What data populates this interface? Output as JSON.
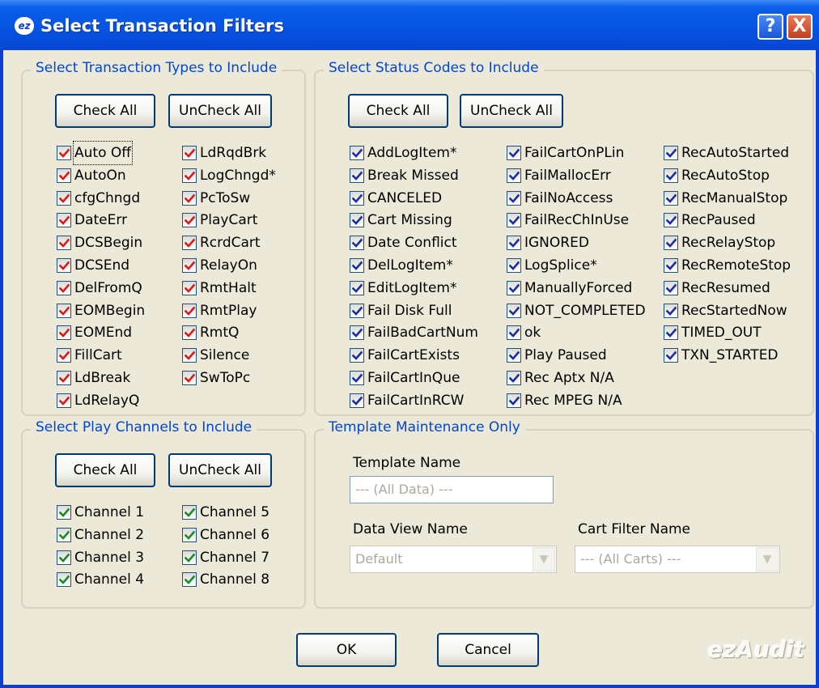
{
  "window": {
    "title": "Select Transaction Filters",
    "help_label": "?",
    "close_label": "X"
  },
  "transaction_types": {
    "legend": "Select Transaction Types to Include",
    "check_all": "Check All",
    "uncheck_all": "UnCheck All",
    "items": [
      "Auto Off",
      "AutoOn",
      "cfgChngd",
      "DateErr",
      "DCSBegin",
      "DCSEnd",
      "DelFromQ",
      "EOMBegin",
      "EOMEnd",
      "FillCart",
      "LdBreak",
      "LdRelayQ",
      "LdRqdBrk",
      "LogChngd*",
      "PcToSw",
      "PlayCart",
      "RcrdCart",
      "RelayOn",
      "RmtHalt",
      "RmtPlay",
      "RmtQ",
      "Silence",
      "SwToPc"
    ]
  },
  "status_codes": {
    "legend": "Select Status Codes to Include",
    "check_all": "Check All",
    "uncheck_all": "UnCheck All",
    "items": [
      "AddLogItem*",
      "Break Missed",
      "CANCELED",
      "Cart Missing",
      "Date Conflict",
      "DelLogItem*",
      "EditLogItem*",
      "Fail Disk Full",
      "FailBadCartNum",
      "FailCartExists",
      "FailCartInQue",
      "FailCartInRCW",
      "FailCartOnPLin",
      "FailMallocErr",
      "FailNoAccess",
      "FailRecChInUse",
      "IGNORED",
      "LogSplice*",
      "ManuallyForced",
      "NOT_COMPLETED",
      "ok",
      "Play Paused",
      "Rec Aptx N/A",
      "Rec MPEG N/A",
      "RecAutoStarted",
      "RecAutoStop",
      "RecManualStop",
      "RecPaused",
      "RecRelayStop",
      "RecRemoteStop",
      "RecResumed",
      "RecStartedNow",
      "TIMED_OUT",
      "TXN_STARTED"
    ]
  },
  "play_channels": {
    "legend": "Select Play Channels to Include",
    "check_all": "Check All",
    "uncheck_all": "UnCheck All",
    "items": [
      "Channel 1",
      "Channel 2",
      "Channel 3",
      "Channel 4",
      "Channel 5",
      "Channel 6",
      "Channel 7",
      "Channel 8"
    ]
  },
  "template": {
    "legend": "Template Maintenance Only",
    "template_name_label": "Template Name",
    "template_name_placeholder": "--- (All Data) ---",
    "data_view_label": "Data View Name",
    "data_view_value": "Default",
    "cart_filter_label": "Cart Filter Name",
    "cart_filter_value": "--- (All Carts) ---"
  },
  "footer": {
    "ok_label": "OK",
    "cancel_label": "Cancel",
    "logo_text": "ezAudit"
  },
  "colors": {
    "check_red": "#d81a1a",
    "check_blue": "#1b2f9c",
    "check_green": "#1a8a2a",
    "legend_blue": "#0046d5",
    "title_blue": "#0554e3"
  }
}
